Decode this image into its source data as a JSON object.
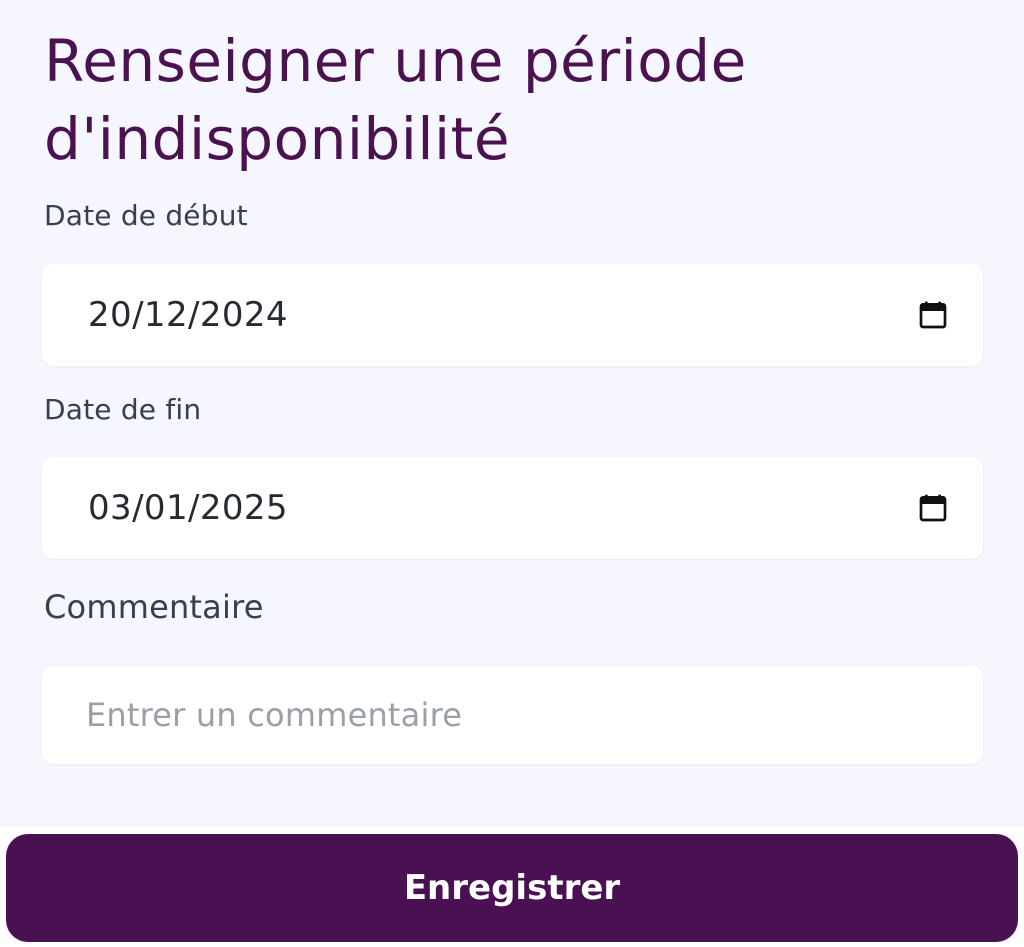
{
  "page": {
    "title": "Renseigner une période d'indisponibilité"
  },
  "form": {
    "start_date": {
      "label": "Date de début",
      "value": "20/12/2024",
      "icon": "calendar-icon"
    },
    "end_date": {
      "label": "Date de fin",
      "value": "03/01/2025",
      "icon": "calendar-icon"
    },
    "comment": {
      "label": "Commentaire",
      "placeholder": "Entrer un commentaire",
      "value": ""
    }
  },
  "actions": {
    "save_label": "Enregistrer"
  },
  "colors": {
    "background": "#f5f6fe",
    "title": "#4a124f",
    "primary_button": "#4a1152",
    "field_background": "#ffffff"
  }
}
